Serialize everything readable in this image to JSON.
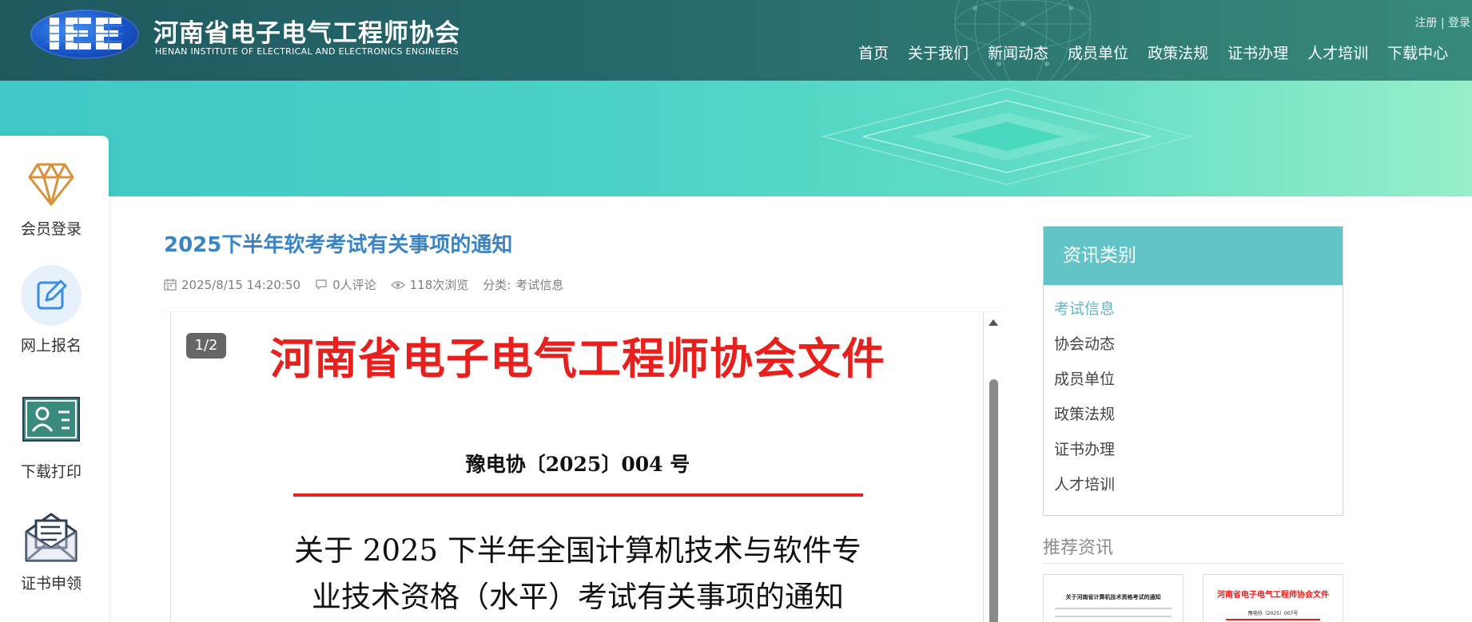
{
  "header": {
    "logo_text": "IEE",
    "site_title": "河南省电子电气工程师协会",
    "site_subtitle": "HENAN INSTITUTE OF ELECTRICAL AND ELECTRONICS ENGINEERS",
    "auth": {
      "register": "注册",
      "separator": "|",
      "login": "登录"
    },
    "nav": [
      {
        "label": "首页"
      },
      {
        "label": "关于我们"
      },
      {
        "label": "新闻动态"
      },
      {
        "label": "成员单位"
      },
      {
        "label": "政策法规"
      },
      {
        "label": "证书办理"
      },
      {
        "label": "人才培训"
      },
      {
        "label": "下载中心"
      }
    ]
  },
  "sidebar": {
    "items": [
      {
        "label": "会员登录",
        "icon": "diamond-icon"
      },
      {
        "label": "网上报名",
        "icon": "edit-icon"
      },
      {
        "label": "下载打印",
        "icon": "id-card-icon"
      },
      {
        "label": "证书申领",
        "icon": "envelope-icon"
      }
    ]
  },
  "article": {
    "title": "2025下半年软考考试有关事项的通知",
    "meta": {
      "datetime": "2025/8/15 14:20:50",
      "comments": "0人评论",
      "views": "118次浏览",
      "category_label": "分类:",
      "category": "考试信息"
    }
  },
  "viewer": {
    "page_indicator": "1/2",
    "document": {
      "heading": "河南省电子电气工程师协会文件",
      "number": "豫电协〔2025〕004 号",
      "subject_line1": "关于 2025 下半年全国计算机技术与软件专",
      "subject_line2": "业技术资格（水平）考试有关事项的通知"
    }
  },
  "categories": {
    "title": "资讯类别",
    "items": [
      {
        "label": "考试信息",
        "active": true
      },
      {
        "label": "协会动态"
      },
      {
        "label": "成员单位"
      },
      {
        "label": "政策法规"
      },
      {
        "label": "证书办理"
      },
      {
        "label": "人才培训"
      }
    ]
  },
  "recommended": {
    "title": "推荐资讯",
    "thumbs": [
      {
        "heading": "关于河南省计算机技术资格考试的通知"
      },
      {
        "heading": "河南省电子电气工程师协会文件",
        "number": "豫电协〔2025〕007号"
      }
    ]
  },
  "colors": {
    "header_bg": "#276a6c",
    "banner_bg": "#4ad2c6",
    "title_blue": "#3a84c6",
    "category_header": "#63c4c7",
    "category_active": "#5fb9c0",
    "document_red": "#e8201d"
  }
}
